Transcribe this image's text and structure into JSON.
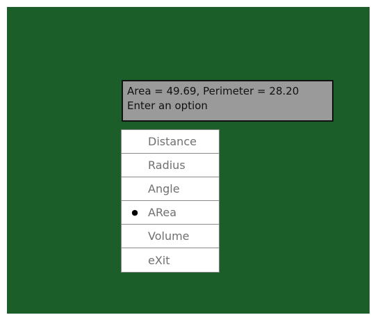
{
  "tooltip": {
    "line1": "Area = 49.69, Perimeter = 28.20",
    "line2": "Enter an option"
  },
  "menu": {
    "items": [
      {
        "label": "Distance",
        "selected": false
      },
      {
        "label": "Radius",
        "selected": false
      },
      {
        "label": "Angle",
        "selected": false
      },
      {
        "label": "ARea",
        "selected": true
      },
      {
        "label": "Volume",
        "selected": false
      },
      {
        "label": "eXit",
        "selected": false
      }
    ],
    "selected_marker": "●"
  },
  "colors": {
    "background": "#1b5e29",
    "tooltip_bg": "#9a9a9a",
    "menu_bg": "#ffffff",
    "menu_text": "#707070"
  }
}
